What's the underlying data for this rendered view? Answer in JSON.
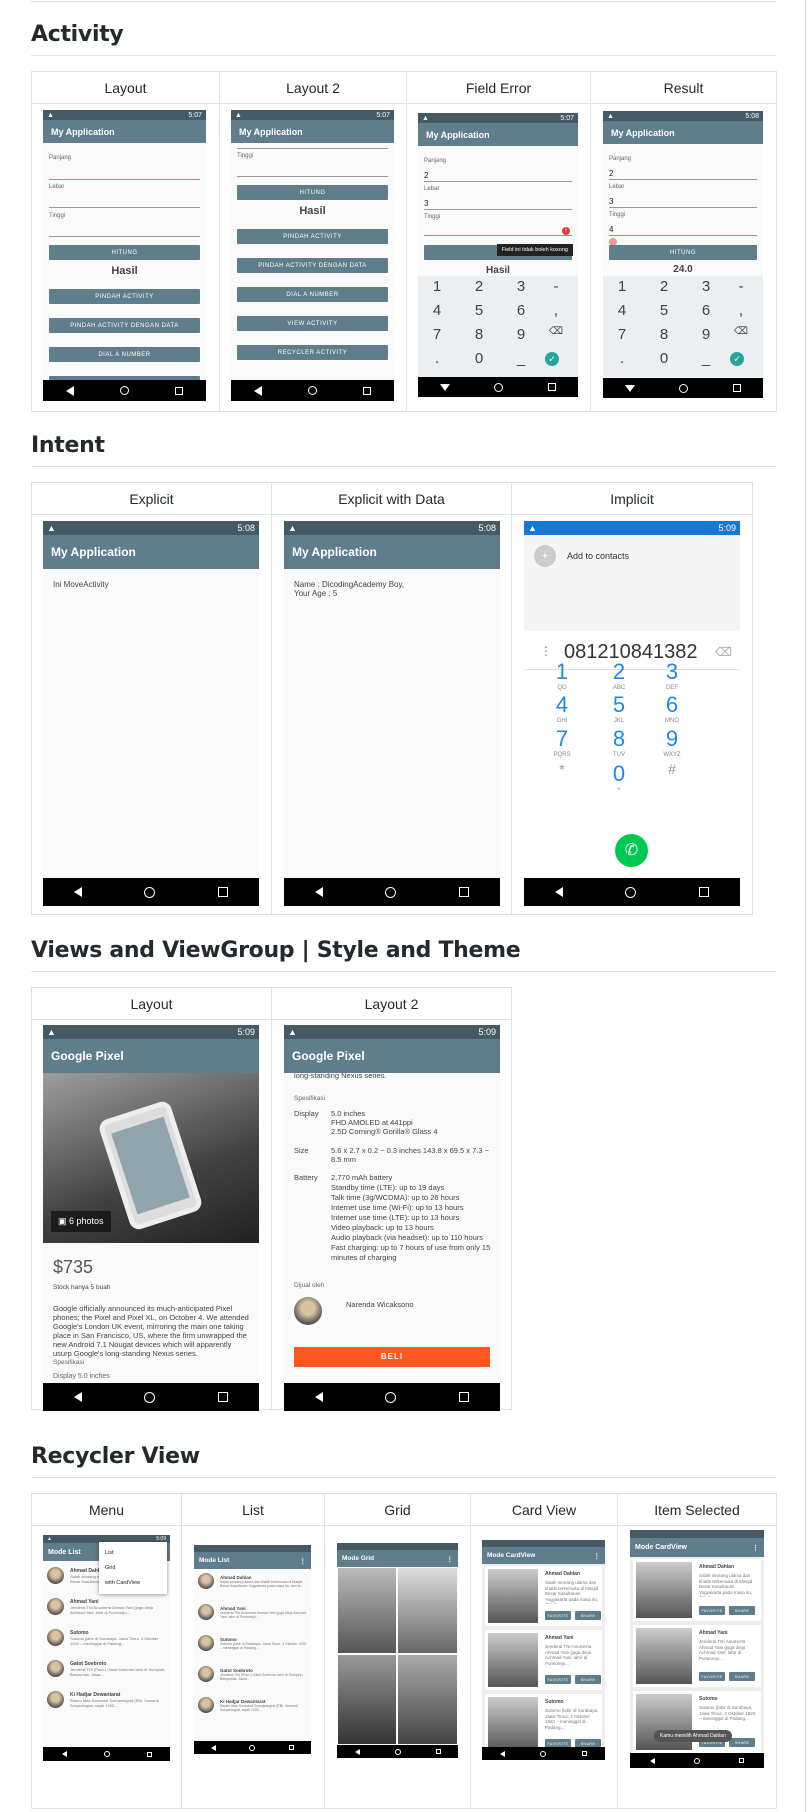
{
  "sections": {
    "activity": "Activity",
    "intent": "Intent",
    "views": "Views and ViewGroup | Style and Theme",
    "recycler": "Recycler View"
  },
  "activity_cols": [
    "Layout",
    "Layout 2",
    "Field Error",
    "Result"
  ],
  "intent_cols": [
    "Explicit",
    "Explicit with Data",
    "Implicit"
  ],
  "views_cols": [
    "Layout",
    "Layout 2"
  ],
  "recycler_cols": [
    "Menu",
    "List",
    "Grid",
    "Card View",
    "Item Selected"
  ],
  "status": {
    "t1": "5:07",
    "t2": "5:08",
    "t3": "5:09"
  },
  "app": {
    "title": "My Application",
    "pixel": "Google Pixel",
    "mode_list": "Mode List",
    "mode_grid": "Mode Grid",
    "mode_card": "Mode CardView"
  },
  "form": {
    "panjang": "Panjang",
    "lebar": "Lebar",
    "tinggi": "Tinggi",
    "hitung": "HITUNG",
    "hasil": "Hasil",
    "pindah": "PINDAH ACTIVITY",
    "pindah_data": "PINDAH ACTIVITY DENGAN DATA",
    "dial": "DIAL A NUMBER",
    "view": "VIEW ACTIVITY",
    "recycler": "RECYCLER ACTIVITY",
    "v2": "2",
    "v3": "3",
    "v4": "4",
    "error": "Field ini tidak boleh kosong",
    "result": "24.0"
  },
  "intent": {
    "move": "Ini MoveActivity",
    "data": "Name : DicodingAcademy Boy,\nYour Age : 5",
    "add": "Add to contacts",
    "number": "081210841382"
  },
  "dial": [
    {
      "n": "1",
      "s": "QO"
    },
    {
      "n": "2",
      "s": "ABC"
    },
    {
      "n": "3",
      "s": "DEF"
    },
    {
      "n": "4",
      "s": "GHI"
    },
    {
      "n": "5",
      "s": "JKL"
    },
    {
      "n": "6",
      "s": "MNO"
    },
    {
      "n": "7",
      "s": "PQRS"
    },
    {
      "n": "8",
      "s": "TUV"
    },
    {
      "n": "9",
      "s": "WXYZ"
    },
    {
      "n": "*",
      "s": ""
    },
    {
      "n": "0",
      "s": "+"
    },
    {
      "n": "#",
      "s": ""
    }
  ],
  "pixel": {
    "photos": "6 photos",
    "price": "$735",
    "stock": "Stock hanya 5 buah",
    "desc": "Google officially announced its much-anticipated Pixel phones; the Pixel and Pixel XL, on October 4. We attended Google's London UK event, mirroring the main one taking place in San Francisco, US, where the firm unwrapped the new Android 7.1 Nougat devices which will apparently usurp Google's long-standing Nexus series.",
    "spek": "Spesifikasi",
    "disp_short": "Display    5.0 inches",
    "top": "long-standing Nexus series.",
    "display_l": "Display",
    "display_v": "5.0 inches\nFHD AMOLED at 441ppi\n2.5D Corning® Gorilla® Glass 4",
    "size_l": "Size",
    "size_v": "5.6 x 2.7 x 0.2 ~ 0.3 inches 143.8 x 69.5 x 7.3 ~ 8.5 mm",
    "bat_l": "Battery",
    "bat_v": "2,770 mAh battery\nStandby time (LTE): up to 19 days\nTalk time (3g/WCDMA): up to 26 hours\nInternet use time (Wi-Fi): up to 13 hours\nInternet use time (LTE): up to 13 hours\nVideo playback: up to 13 hours\nAudio playback (via headset): up to 110 hours\nFast charging: up to 7 hours of use from only 15 minutes of charging",
    "dijual": "Dijual oleh",
    "seller": "Narenda Wicaksono",
    "beli": "BELI"
  },
  "menu": [
    "List",
    "Grid",
    "with CardView"
  ],
  "heroes": [
    {
      "name": "Ahmad Dahlan",
      "desc": "Salah seorang ulama dan khatib terkemuka di Masjid Besar Kasultanan Yogyakarta pada masa itu, dan ia..."
    },
    {
      "name": "Ahmad Yani",
      "desc": "Jenderal TNI Anumerta Ahmad Yani (juga dieja Achmad Yani; lahir di Purworejo..."
    },
    {
      "name": "Sutomo",
      "desc": "Sutomo (lahir di Surabaya, Jawa Timur, 3 Oktober 1920 – meninggal di Padang..."
    },
    {
      "name": "Gatot Soebroto",
      "desc": "Jenderal TNI (Purn.) Gatot Soebroto lahir di Sumpiuh, Banyumas, Jawa..."
    },
    {
      "name": "Ki Hadjar Dewantarat",
      "desc": "Raden Mas Soewardi Soerjaningrat (EBI: Suwardi Suryaningrat, sejak 1922..."
    }
  ],
  "card": {
    "favorite": "FAVORITE",
    "share": "SHARE",
    "toast": "Kamu memilih Ahmad Dahlan"
  }
}
